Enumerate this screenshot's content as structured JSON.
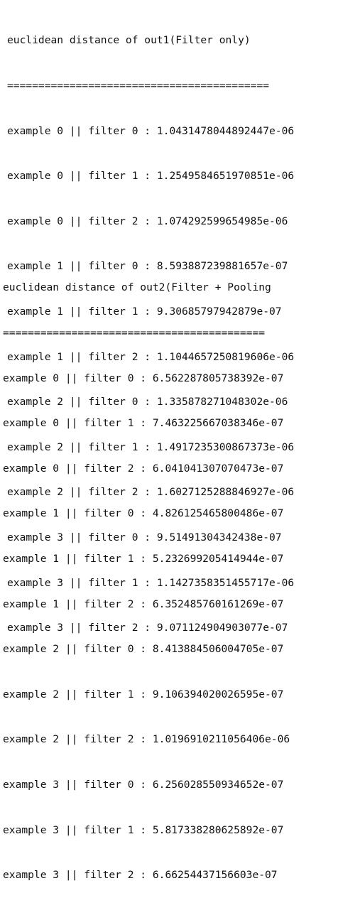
{
  "output_blocks": [
    {
      "title": "euclidean distance of out1(Filter only)",
      "separator": "==========================================",
      "rows": [
        "example 0 || filter 0 : 1.0431478044892447e-06",
        "example 0 || filter 1 : 1.2549584651970851e-06",
        "example 0 || filter 2 : 1.074292599654985e-06",
        "example 1 || filter 0 : 8.593887239881657e-07",
        "example 1 || filter 1 : 9.30685797942879e-07",
        "example 1 || filter 2 : 1.1044657250819606e-06",
        "example 2 || filter 0 : 1.335878271048302e-06",
        "example 2 || filter 1 : 1.4917235300867373e-06",
        "example 2 || filter 2 : 1.6027125288846927e-06",
        "example 3 || filter 0 : 9.51491304342438e-07",
        "example 3 || filter 1 : 1.1427358351455717e-06",
        "example 3 || filter 2 : 9.071124904903077e-07"
      ]
    },
    {
      "title": "euclidean distance of out2(Filter + Pooling",
      "separator": "==========================================",
      "rows": [
        "example 0 || filter 0 : 6.562287805738392e-07",
        "example 0 || filter 1 : 7.463225667038346e-07",
        "example 0 || filter 2 : 6.041041307070473e-07",
        "example 1 || filter 0 : 4.826125465800486e-07",
        "example 1 || filter 1 : 5.232699205414944e-07",
        "example 1 || filter 2 : 6.352485760161269e-07",
        "example 2 || filter 0 : 8.413884506004705e-07",
        "example 2 || filter 1 : 9.106394020026595e-07",
        "example 2 || filter 2 : 1.0196910211056406e-06",
        "example 3 || filter 0 : 6.256028550934652e-07",
        "example 3 || filter 1 : 5.817338280625892e-07",
        "example 3 || filter 2 : 6.66254437156603e-07"
      ]
    }
  ]
}
